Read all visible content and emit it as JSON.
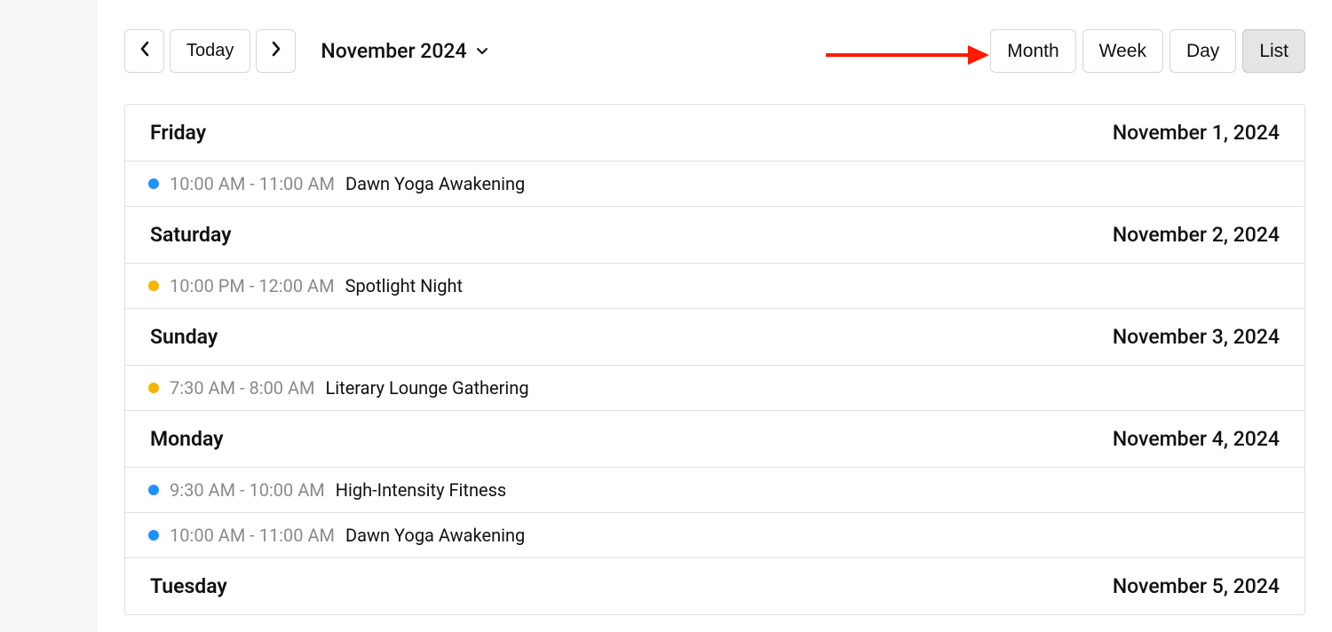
{
  "toolbar": {
    "today_label": "Today",
    "title": "November 2024"
  },
  "views": [
    {
      "key": "month",
      "label": "Month",
      "active": false
    },
    {
      "key": "week",
      "label": "Week",
      "active": false
    },
    {
      "key": "day",
      "label": "Day",
      "active": false
    },
    {
      "key": "list",
      "label": "List",
      "active": true
    }
  ],
  "colors": {
    "blue": "#1e90ff",
    "amber": "#f4b400"
  },
  "days": [
    {
      "name": "Friday",
      "date": "November 1, 2024",
      "events": [
        {
          "color": "blue",
          "time": "10:00 AM - 11:00 AM",
          "title": "Dawn Yoga Awakening"
        }
      ]
    },
    {
      "name": "Saturday",
      "date": "November 2, 2024",
      "events": [
        {
          "color": "amber",
          "time": "10:00 PM - 12:00 AM",
          "title": "Spotlight Night"
        }
      ]
    },
    {
      "name": "Sunday",
      "date": "November 3, 2024",
      "events": [
        {
          "color": "amber",
          "time": "7:30 AM - 8:00 AM",
          "title": "Literary Lounge Gathering"
        }
      ]
    },
    {
      "name": "Monday",
      "date": "November 4, 2024",
      "events": [
        {
          "color": "blue",
          "time": "9:30 AM - 10:00 AM",
          "title": "High-Intensity Fitness"
        },
        {
          "color": "blue",
          "time": "10:00 AM - 11:00 AM",
          "title": "Dawn Yoga Awakening"
        }
      ]
    },
    {
      "name": "Tuesday",
      "date": "November 5, 2024",
      "events": []
    }
  ]
}
